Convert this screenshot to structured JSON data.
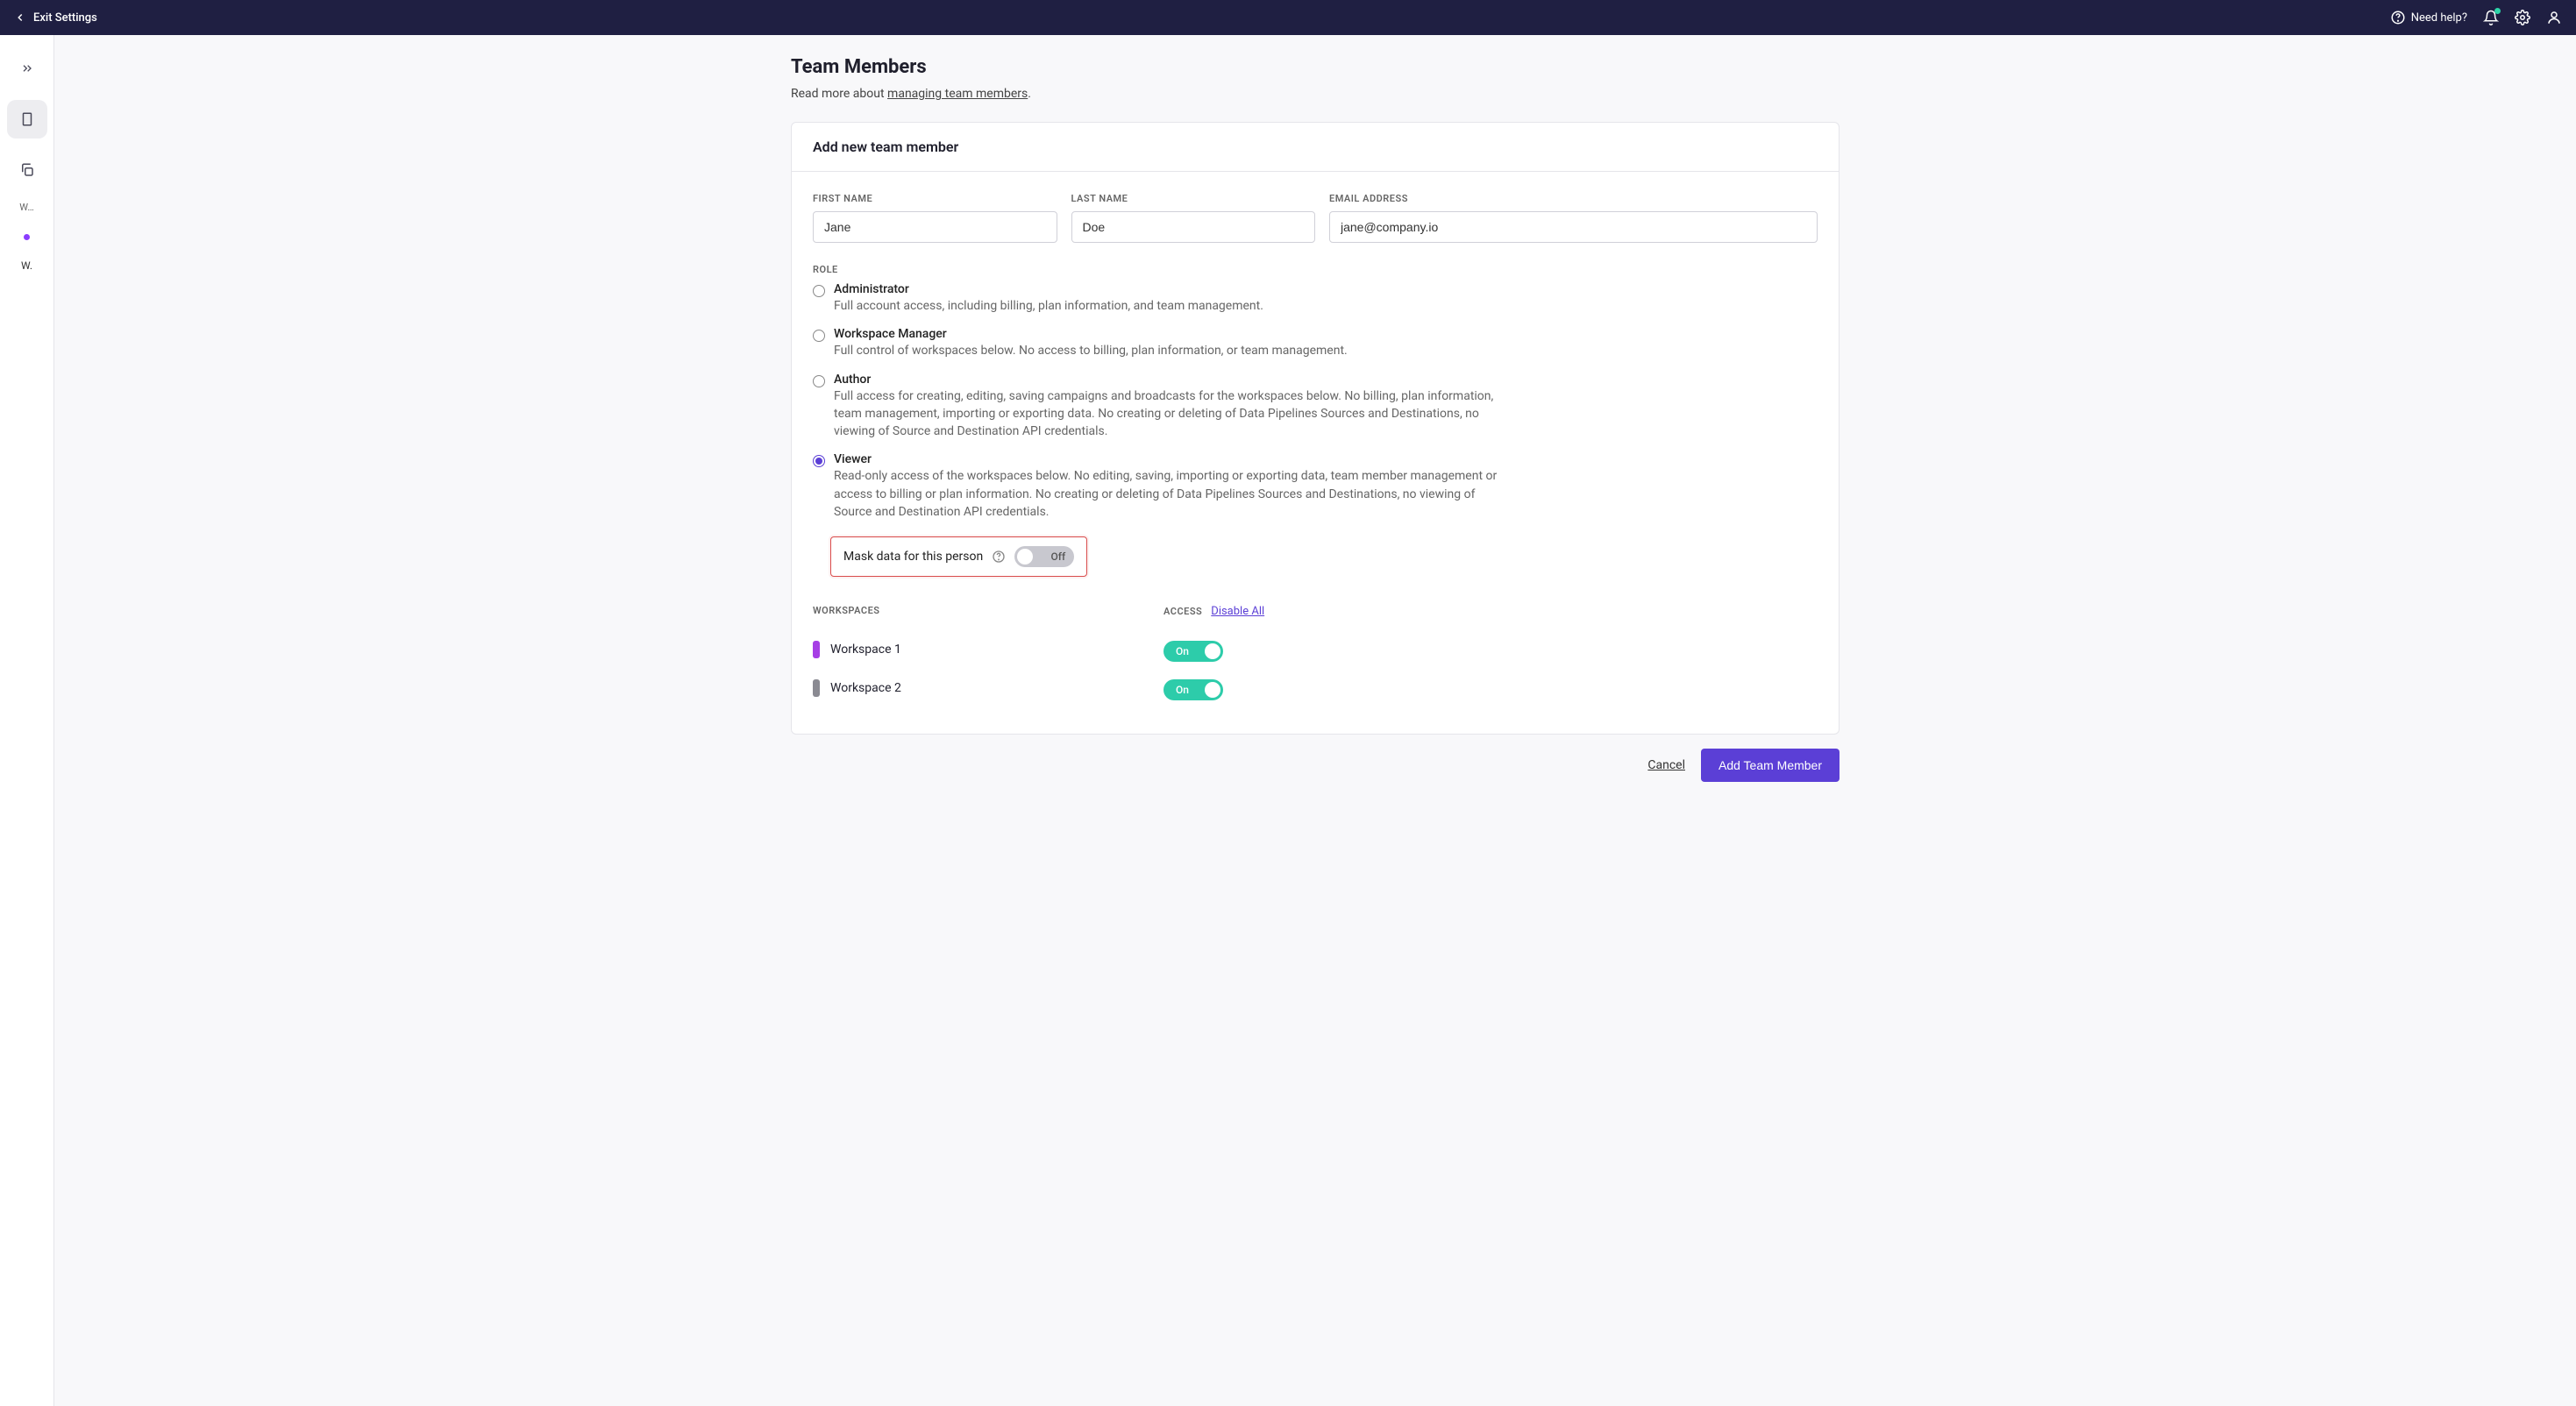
{
  "topbar": {
    "exit": "Exit Settings",
    "help": "Need help?"
  },
  "sidebar": {
    "label1": "W…",
    "label2": "W."
  },
  "page": {
    "title": "Team Members",
    "subtitle_prefix": "Read more about ",
    "subtitle_link": "managing team members",
    "subtitle_suffix": "."
  },
  "card": {
    "header": "Add new team member",
    "first_name_label": "First Name",
    "first_name_value": "Jane",
    "last_name_label": "Last Name",
    "last_name_value": "Doe",
    "email_label": "Email Address",
    "email_value": "jane@company.io"
  },
  "role_label": "Role",
  "roles": [
    {
      "title": "Administrator",
      "desc": "Full account access, including billing, plan information, and team management.",
      "selected": false
    },
    {
      "title": "Workspace Manager",
      "desc": "Full control of workspaces below. No access to billing, plan information, or team management.",
      "selected": false
    },
    {
      "title": "Author",
      "desc": "Full access for creating, editing, saving campaigns and broadcasts for the workspaces below. No billing, plan information, team management, importing or exporting data. No creating or deleting of Data Pipelines Sources and Destinations, no viewing of Source and Destination API credentials.",
      "selected": false
    },
    {
      "title": "Viewer",
      "desc": "Read-only access of the workspaces below. No editing, saving, importing or exporting data, team member management or access to billing or plan information. No creating or deleting of Data Pipelines Sources and Destinations, no viewing of Source and Destination API credentials.",
      "selected": true
    }
  ],
  "mask": {
    "label": "Mask data for this person",
    "toggle_text": "Off"
  },
  "ws": {
    "header": "Workspaces",
    "access": "Access",
    "disable_all": "Disable All",
    "rows": [
      {
        "name": "Workspace 1",
        "color": "#a63ee5",
        "on": true,
        "toggle_text": "On"
      },
      {
        "name": "Workspace 2",
        "color": "#8a8a92",
        "on": true,
        "toggle_text": "On"
      }
    ]
  },
  "actions": {
    "cancel": "Cancel",
    "submit": "Add Team Member"
  }
}
